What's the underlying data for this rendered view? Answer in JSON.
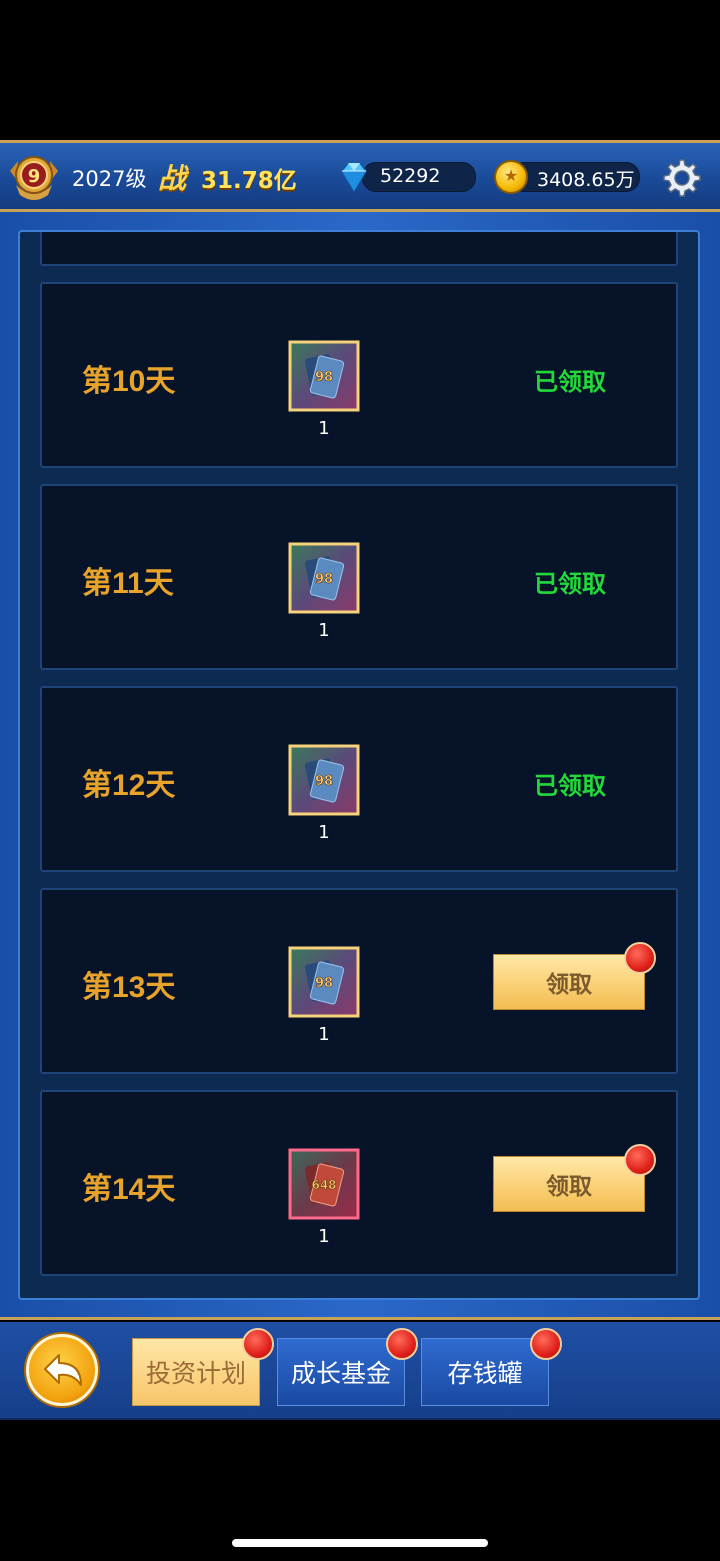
{
  "header": {
    "vip_level": "9",
    "player_level": "2027级",
    "power_icon_text": "战",
    "power_value": "31.78亿",
    "diamonds": "52292",
    "gold": "3408.65万",
    "icons": [
      "vip-badge-icon",
      "diamond-icon",
      "gold-coin-icon",
      "gear-icon"
    ]
  },
  "rewards": [
    {
      "day": "第10天",
      "item_value": "98",
      "count": "1",
      "status": "已领取",
      "claimed": true,
      "tier": "blue"
    },
    {
      "day": "第11天",
      "item_value": "98",
      "count": "1",
      "status": "已领取",
      "claimed": true,
      "tier": "blue"
    },
    {
      "day": "第12天",
      "item_value": "98",
      "count": "1",
      "status": "已领取",
      "claimed": true,
      "tier": "blue"
    },
    {
      "day": "第13天",
      "item_value": "98",
      "count": "1",
      "status": "领取",
      "claimed": false,
      "tier": "blue"
    },
    {
      "day": "第14天",
      "item_value": "648",
      "count": "1",
      "status": "领取",
      "claimed": false,
      "tier": "red"
    }
  ],
  "bottom_tabs": [
    {
      "label": "投资计划",
      "active": true,
      "has_notification": true
    },
    {
      "label": "成长基金",
      "active": false,
      "has_notification": true
    },
    {
      "label": "存钱罐",
      "active": false,
      "has_notification": true
    }
  ],
  "colors": {
    "claimed_text": "#22d83a",
    "day_label": "#e8a42a",
    "power_value": "#ffe35a"
  }
}
